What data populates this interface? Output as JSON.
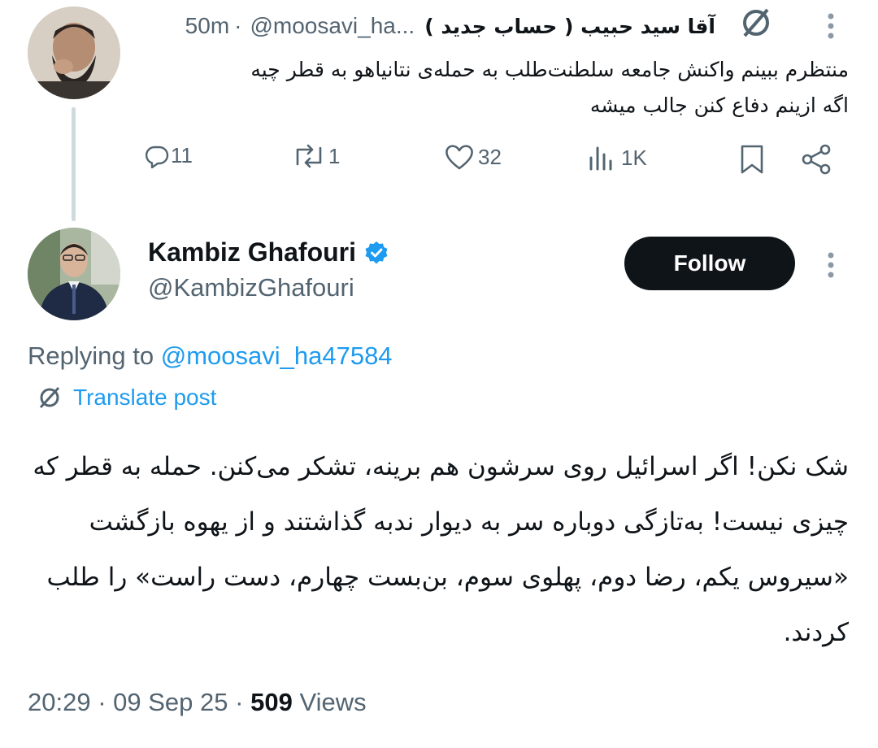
{
  "reply_tweet": {
    "display_name": "آقا سید حبیب ( حساب جدید )",
    "handle": "@moosavi_ha...",
    "time_sep": "·",
    "time": "50m",
    "text_line1": "منتظرم ببینم واکنش جامعه سلطنت‌طلب به حمله‌ی نتانیاهو به قطر چیه",
    "text_line2": "اگه ازینم دفاع کنن جالب میشه",
    "actions": {
      "replies": "11",
      "reposts": "1",
      "likes": "32",
      "views": "1K"
    }
  },
  "main_tweet": {
    "display_name": "Kambiz Ghafouri",
    "handle": "@KambizGhafouri",
    "follow_label": "Follow",
    "replying_prefix": "Replying to",
    "replying_handle": "@moosavi_ha47584",
    "translate_label": "Translate post",
    "text": "شک نکن! اگر اسرائیل روی سرشون هم برینه، تشکر می‌کنن. حمله به قطر که چیزی نیست! به‌تازگی دوباره سر به دیوار ندبه گذاشتند و از یهوه بازگشت «سیروس یکم، رضا دوم، پهلوی سوم، بن‌بست چهارم، دست راست» را طلب کردند.",
    "time": "20:29",
    "sep1": "·",
    "date": "09 Sep 25",
    "sep2": "·",
    "views_count": "509",
    "views_label": "Views"
  },
  "icons": [
    "translate-icon",
    "more-icon",
    "reply-icon",
    "repost-icon",
    "like-icon",
    "views-icon",
    "bookmark-icon",
    "share-icon",
    "verified-icon"
  ],
  "colors": {
    "text": "#0f1419",
    "secondary": "#536471",
    "link": "#1d9bf0",
    "follow_bg": "#0f1419",
    "verified": "#1d9bf0"
  }
}
